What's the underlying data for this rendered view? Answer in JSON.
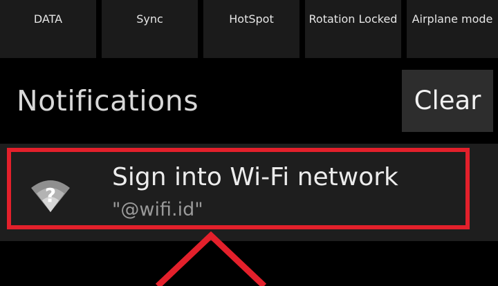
{
  "quick_settings": {
    "tiles": [
      {
        "label": "DATA"
      },
      {
        "label": "Sync"
      },
      {
        "label": "HotSpot"
      },
      {
        "label": "Rotation Locked"
      },
      {
        "label": "Airplane mode"
      }
    ]
  },
  "notifications": {
    "title": "Notifications",
    "clear_label": "Clear",
    "items": [
      {
        "icon": "wifi-question-icon",
        "title": "Sign into Wi-Fi network",
        "subtitle": "\"@wifi.id\""
      }
    ]
  },
  "colors": {
    "background": "#000000",
    "tile": "#1b1b1b",
    "card": "#1e1e1e",
    "highlight": "#e3202b"
  }
}
